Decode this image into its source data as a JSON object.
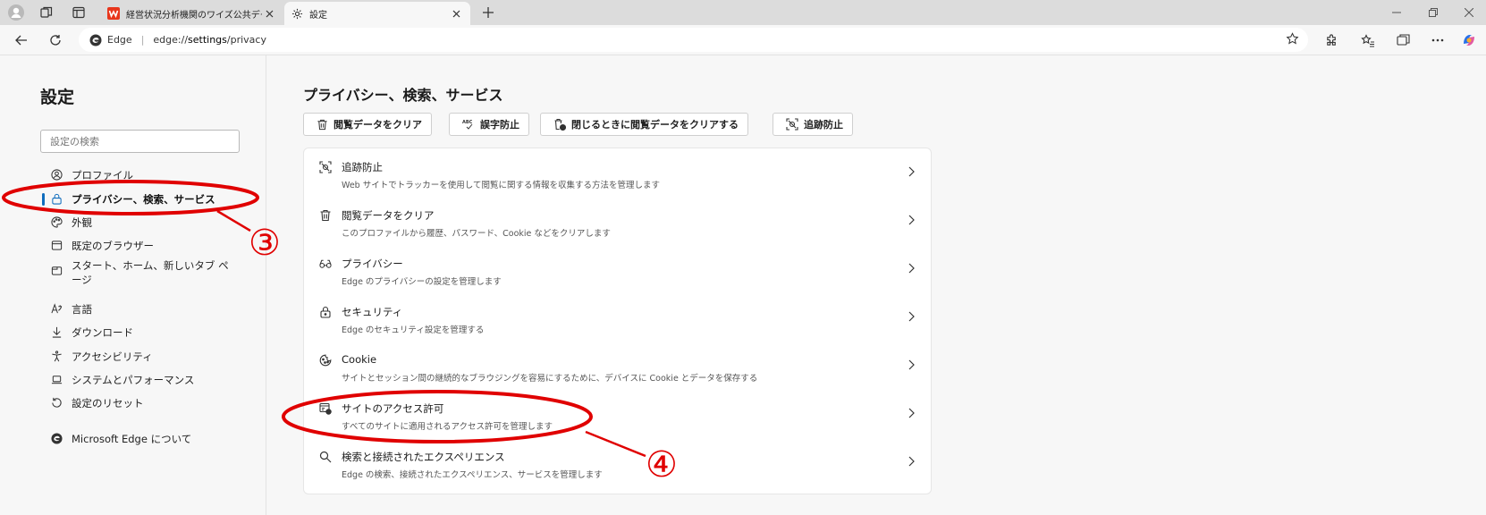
{
  "tabs": [
    {
      "title": "経営状況分析機関のワイズ公共デー",
      "favicon": "w-logo"
    },
    {
      "title": "設定",
      "favicon": "gear-icon"
    }
  ],
  "addressbar": {
    "brand": "Edge",
    "url_prefix": "edge://",
    "url_strong": "settings",
    "url_suffix": "/privacy"
  },
  "sidebar": {
    "title": "設定",
    "search_placeholder": "設定の検索",
    "items": [
      {
        "label": "プロファイル",
        "icon": "profile-icon"
      },
      {
        "label": "プライバシー、検索、サービス",
        "icon": "lock-icon",
        "active": true
      },
      {
        "label": "外観",
        "icon": "appearance-icon"
      },
      {
        "label": "既定のブラウザー",
        "icon": "browser-icon"
      },
      {
        "label": "スタート、ホーム、新しいタブ ペ",
        "label2": "ージ",
        "icon": "home-tab-icon"
      },
      {
        "label": "言語",
        "icon": "language-icon"
      },
      {
        "label": "ダウンロード",
        "icon": "download-icon"
      },
      {
        "label": "アクセシビリティ",
        "icon": "accessibility-icon"
      },
      {
        "label": "システムとパフォーマンス",
        "icon": "laptop-icon"
      },
      {
        "label": "設定のリセット",
        "icon": "reset-icon"
      },
      {
        "label": "Microsoft Edge について",
        "icon": "edge-logo-icon"
      }
    ]
  },
  "main": {
    "title": "プライバシー、検索、サービス",
    "quick_buttons": [
      {
        "label": "閲覧データをクリア",
        "icon": "trash-icon"
      },
      {
        "label": "誤字防止",
        "icon": "spellcheck-icon"
      },
      {
        "label": "閉じるときに閲覧データをクリアする",
        "icon": "trash-clock-icon"
      },
      {
        "label": "追跡防止",
        "icon": "tracking-icon"
      }
    ],
    "rows": [
      {
        "title": "追跡防止",
        "desc": "Web サイトでトラッカーを使用して閲覧に関する情報を収集する方法を管理します",
        "icon": "tracking-icon"
      },
      {
        "title": "閲覧データをクリア",
        "desc": "このプロファイルから履歴、パスワード、Cookie などをクリアします",
        "icon": "trash-icon"
      },
      {
        "title": "プライバシー",
        "desc": "Edge のプライバシーの設定を管理します",
        "icon": "glasses-icon"
      },
      {
        "title": "セキュリティ",
        "desc": "Edge のセキュリティ設定を管理する",
        "icon": "lock-icon"
      },
      {
        "title": "Cookie",
        "desc": "サイトとセッション間の継続的なブラウジングを容易にするために、デバイスに Cookie とデータを保存する",
        "icon": "cookie-icon"
      },
      {
        "title": "サイトのアクセス許可",
        "desc": "すべてのサイトに適用されるアクセス許可を管理します",
        "icon": "site-permissions-icon"
      },
      {
        "title": "検索と接続されたエクスペリエンス",
        "desc": "Edge の検索、接続されたエクスペリエンス、サービスを管理します",
        "icon": "search-icon"
      }
    ]
  },
  "annotations": {
    "callout_3": "③",
    "callout_4": "④",
    "color": "#e00000"
  },
  "colors": {
    "accent": "#0f6cbd",
    "tabstrip": "#dcdcdc",
    "page_bg": "#f7f7f7"
  }
}
